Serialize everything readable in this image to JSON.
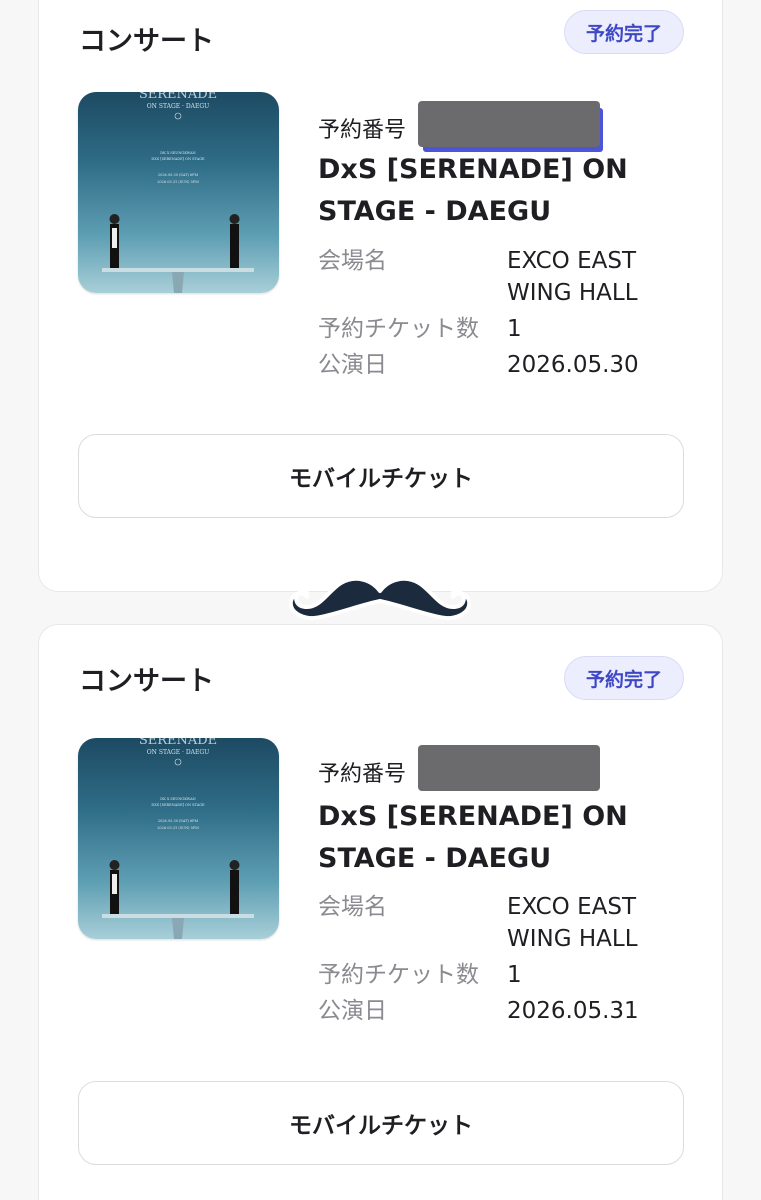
{
  "tickets": [
    {
      "category": "コンサート",
      "status": "予約完了",
      "reservation_label": "予約番号",
      "title": "DxS [SERENADE] ON STAGE - DAEGU",
      "venue_label": "会場名",
      "venue": "EXCO EAST WING HALL",
      "count_label": "予約チケット数",
      "count": "1",
      "date_label": "公演日",
      "date": "2026.05.30",
      "button": "モバイルチケット"
    },
    {
      "category": "コンサート",
      "status": "予約完了",
      "reservation_label": "予約番号",
      "title": "DxS [SERENADE] ON STAGE - DAEGU",
      "venue_label": "会場名",
      "venue": "EXCO EAST WING HALL",
      "count_label": "予約チケット数",
      "count": "1",
      "date_label": "公演日",
      "date": "2026.05.31",
      "button": "モバイルチケット"
    }
  ],
  "colors": {
    "status_badge_text": "#3f48c4",
    "status_badge_bg": "#eceefd",
    "mustache": "#1c2a3d"
  },
  "icons": {
    "sticker": "mustache-icon"
  }
}
